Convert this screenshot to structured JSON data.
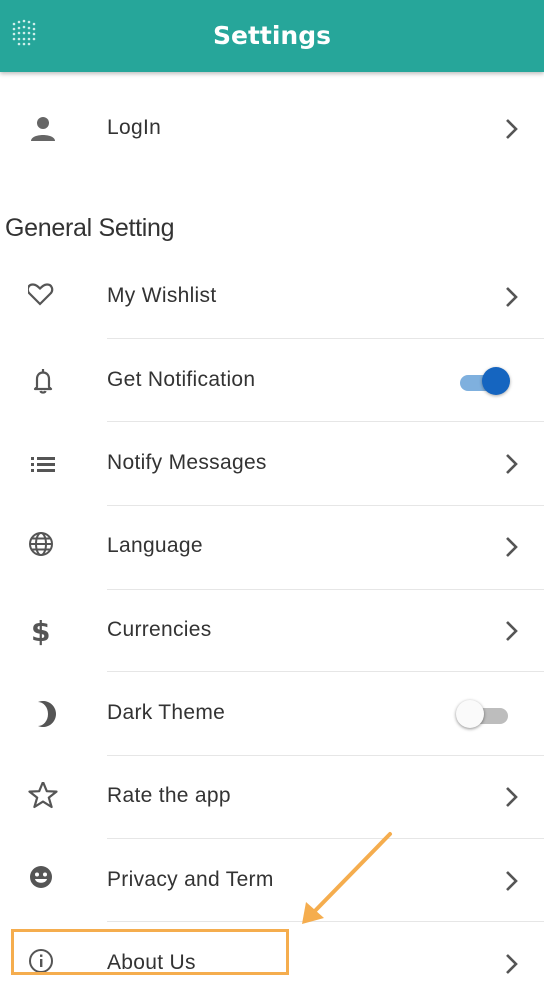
{
  "header": {
    "title": "Settings",
    "menu_icon": "grid-dots-icon",
    "color": "#26a69a"
  },
  "login": {
    "label": "LogIn",
    "icon": "person-icon"
  },
  "general": {
    "title": "General Setting",
    "items": [
      {
        "label": "My Wishlist",
        "icon": "heart-icon",
        "control": "chevron"
      },
      {
        "label": "Get Notification",
        "icon": "bell-icon",
        "control": "toggle",
        "toggle_on": true
      },
      {
        "label": "Notify Messages",
        "icon": "list-icon",
        "control": "chevron"
      },
      {
        "label": "Language",
        "icon": "globe-icon",
        "control": "chevron"
      },
      {
        "label": "Currencies",
        "icon": "dollar-icon",
        "control": "chevron"
      },
      {
        "label": "Dark Theme",
        "icon": "moon-icon",
        "control": "toggle",
        "toggle_on": false
      },
      {
        "label": "Rate the app",
        "icon": "star-icon",
        "control": "chevron"
      },
      {
        "label": "Privacy and Term",
        "icon": "face-icon",
        "control": "chevron"
      },
      {
        "label": "About Us",
        "icon": "info-icon",
        "control": "chevron"
      }
    ]
  },
  "annotation": {
    "color": "#f5ad4e",
    "highlighted_item": "About Us"
  }
}
